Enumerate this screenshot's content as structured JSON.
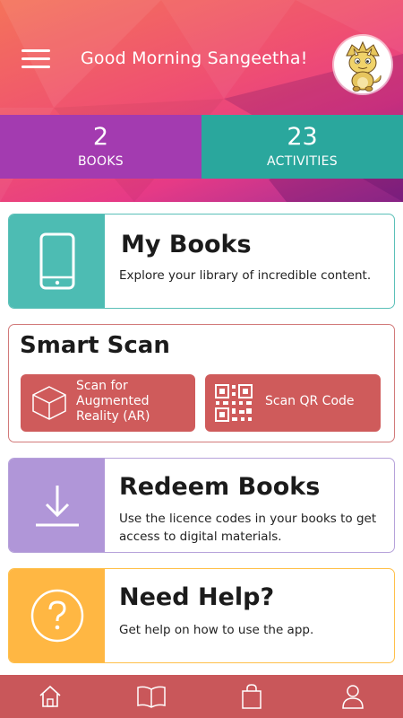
{
  "header": {
    "greeting": "Good Morning Sangeetha!",
    "menu_icon": "hamburger-menu-icon",
    "avatar": "dinosaur-avatar"
  },
  "stats": {
    "books": {
      "value": "2",
      "label": "BOOKS"
    },
    "activities": {
      "value": "23",
      "label": "ACTIVITIES"
    }
  },
  "cards": {
    "my_books": {
      "title": "My Books",
      "description": "Explore your library of incredible content.",
      "icon": "smartphone-icon"
    },
    "smart_scan": {
      "title": "Smart Scan",
      "ar_button": "Scan for Augmented Reality (AR)",
      "qr_button": "Scan QR Code",
      "ar_icon": "ar-cube-icon",
      "qr_icon": "qr-code-icon"
    },
    "redeem": {
      "title": "Redeem Books",
      "description": "Use the licence codes in your books to get access to digital materials.",
      "icon": "download-icon"
    },
    "help": {
      "title": "Need Help?",
      "description": "Get help on how to use the app.",
      "icon": "question-circle-icon"
    }
  },
  "bottom_nav": [
    "home-icon",
    "book-icon",
    "shopping-bag-icon",
    "user-icon"
  ],
  "colors": {
    "books_stat": "#a33bb0",
    "activities_stat": "#2aa79d",
    "my_books": "#4dbcb3",
    "scan_button": "#cf5b5b",
    "redeem": "#b096d8",
    "help": "#ffb743",
    "nav": "#c9575a"
  }
}
